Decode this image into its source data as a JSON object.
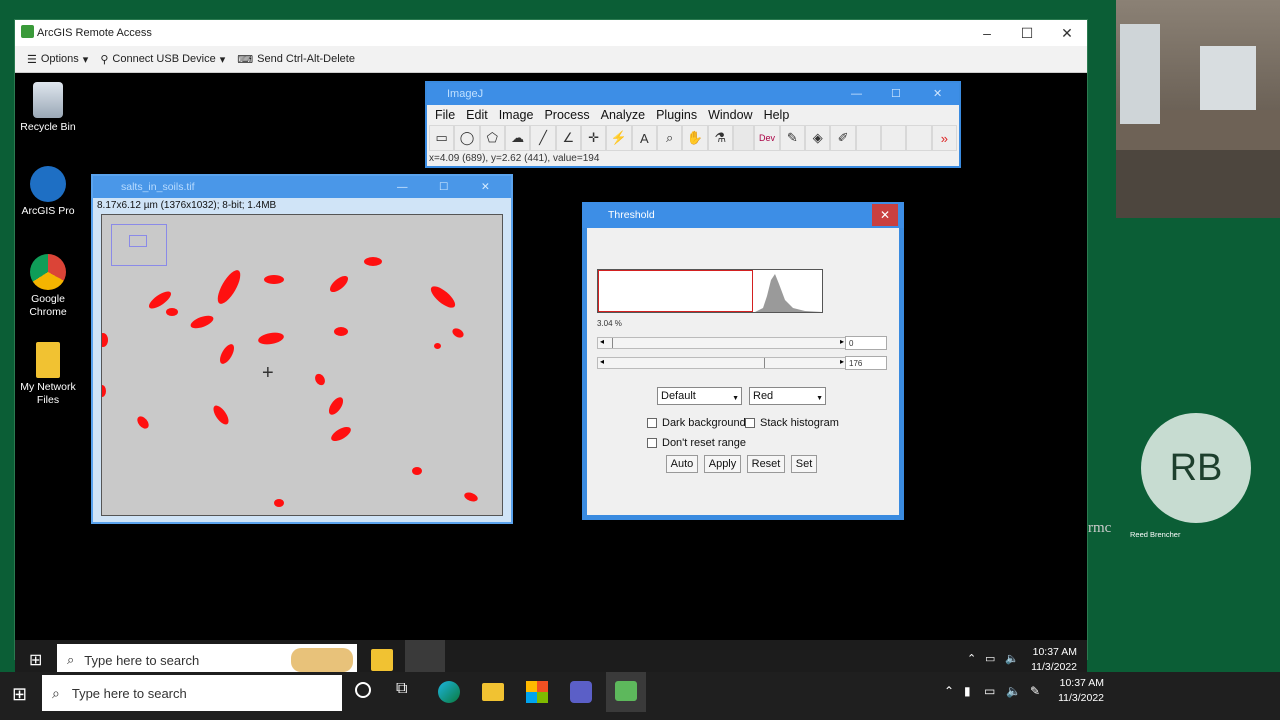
{
  "remote": {
    "title": "ArcGIS Remote Access",
    "toolbar": {
      "options": "Options",
      "usb": "Connect USB Device",
      "cad": "Send Ctrl-Alt-Delete"
    }
  },
  "desktop_icons": [
    "Recycle Bin",
    "ArcGIS Pro",
    "Google Chrome",
    "My Network Files"
  ],
  "imagej": {
    "title": "ImageJ",
    "menu": [
      "File",
      "Edit",
      "Image",
      "Process",
      "Analyze",
      "Plugins",
      "Window",
      "Help"
    ],
    "status": "x=4.09 (689), y=2.62 (441), value=194",
    "dev_label": "Dev"
  },
  "image_window": {
    "title": "salts_in_soils.tif",
    "info": "8.17x6.12 µm (1376x1032); 8-bit; 1.4MB"
  },
  "threshold": {
    "title": "Threshold",
    "percent": "3.04 %",
    "min_value": "0",
    "max_value": "176",
    "method": "Default",
    "mode": "Red",
    "dark_background": "Dark background",
    "stack_histogram": "Stack histogram",
    "dont_reset": "Don't reset range",
    "buttons": {
      "auto": "Auto",
      "apply": "Apply",
      "reset": "Reset",
      "set": "Set"
    }
  },
  "inner_taskbar": {
    "search_placeholder": "Type here to search",
    "time": "10:37 AM",
    "date": "11/3/2022"
  },
  "outer_taskbar": {
    "search_placeholder": "Type here to search",
    "time": "10:37 AM",
    "date": "11/3/2022"
  },
  "participant": {
    "initials": "RB",
    "name": "Reed Brencher",
    "edge_text": "rmc"
  },
  "colors": {
    "accent": "#3d8ee6",
    "threshold_red": "#ff1010",
    "meeting_bg": "#0b5e36"
  }
}
